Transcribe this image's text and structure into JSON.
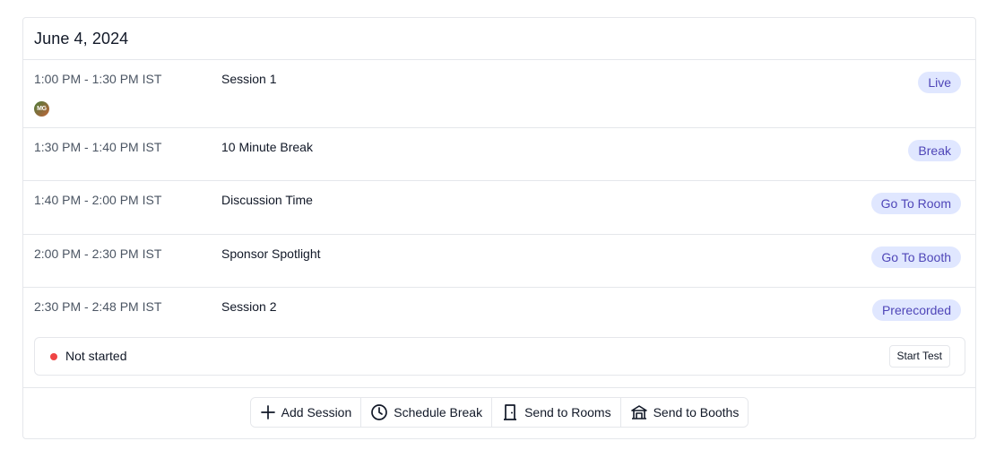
{
  "schedule": {
    "date": "June 4, 2024",
    "sessions": [
      {
        "time": "1:00 PM - 1:30 PM IST",
        "title": "Session 1",
        "badge": "Live",
        "avatar": "MG"
      },
      {
        "time": "1:30 PM - 1:40 PM IST",
        "title": "10 Minute Break",
        "badge": "Break"
      },
      {
        "time": "1:40 PM - 2:00 PM IST",
        "title": "Discussion Time",
        "badge": "Go To Room"
      },
      {
        "time": "2:00 PM - 2:30 PM IST",
        "title": "Sponsor Spotlight",
        "badge": "Go To Booth"
      },
      {
        "time": "2:30 PM - 2:48 PM IST",
        "title": "Session 2",
        "badge": "Prerecorded",
        "status": "Not started",
        "action": "Start Test"
      }
    ]
  },
  "actions": {
    "add_session": "Add Session",
    "schedule_break": "Schedule Break",
    "send_to_rooms": "Send to Rooms",
    "send_to_booths": "Send to Booths"
  },
  "colors": {
    "badge_bg": "#e0e7ff",
    "badge_text": "#4f46b8",
    "status_not_started": "#ef4444",
    "border": "#e5e7eb"
  },
  "icons": {
    "add_session": "plus-icon",
    "schedule_break": "clock-icon",
    "send_to_rooms": "door-icon",
    "send_to_booths": "booth-icon"
  }
}
